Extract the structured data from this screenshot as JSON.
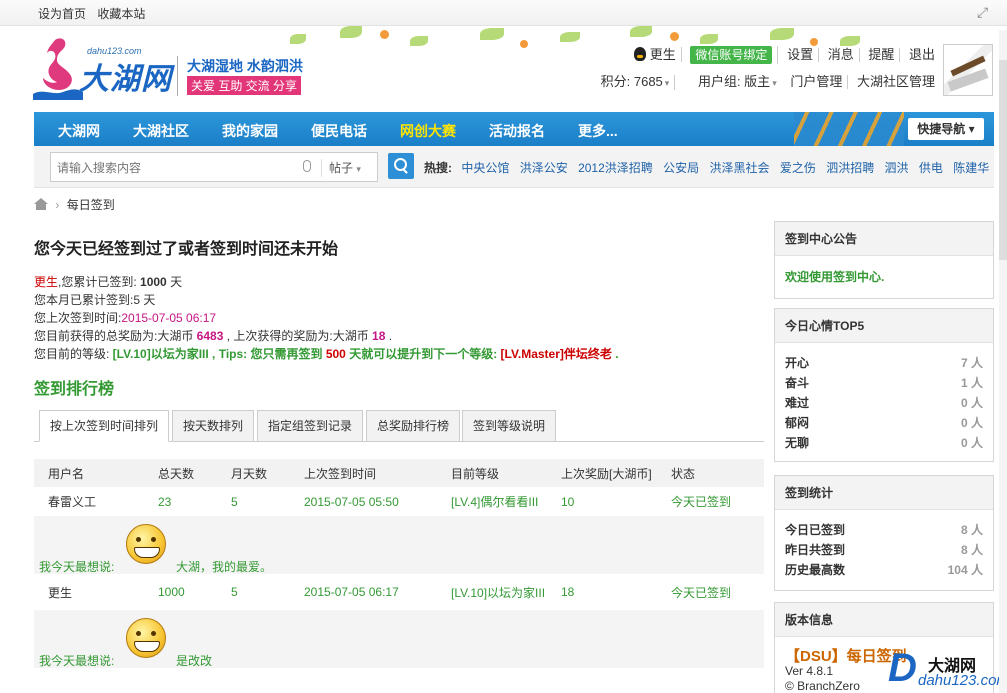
{
  "topbar": {
    "set_home": "设为首页",
    "bookmark": "收藏本站"
  },
  "logo": {
    "domain": "dahu123.com",
    "brand": "大湖网",
    "slogan1": "大湖湿地 水韵泗洪",
    "slogan2": "关爱 互助 交流 分享"
  },
  "user": {
    "name": "更生",
    "wechat": "微信账号绑定",
    "settings": "设置",
    "messages": "消息",
    "reminders": "提醒",
    "logout": "退出",
    "points": "积分: 7685",
    "group": "用户组: 版主",
    "portal_admin": "门户管理",
    "community_admin": "大湖社区管理"
  },
  "nav": {
    "items": [
      "大湖网",
      "大湖社区",
      "我的家园",
      "便民电话",
      "网创大赛",
      "活动报名",
      "更多..."
    ],
    "quick": "快捷导航"
  },
  "search": {
    "placeholder": "请输入搜索内容",
    "scope": "帖子",
    "hot_label": "热搜:",
    "hot": [
      "中央公馆",
      "洪泽公安",
      "2012洪泽招聘",
      "公安局",
      "洪泽黑社会",
      "爱之伤",
      "泗洪招聘",
      "泗洪",
      "供电",
      "陈建华"
    ]
  },
  "breadcrumb": {
    "current": "每日签到"
  },
  "main": {
    "heading": "您今天已经签到过了或者签到时间还未开始",
    "user": "更生",
    "total_prefix": ",您累计已签到: ",
    "total_days": "1000",
    "total_suffix": " 天",
    "month_line": "您本月已累计签到:5 天",
    "last_prefix": "您上次签到时间:",
    "last_time": "2015-07-05 06:17",
    "reward_prefix": "您目前获得的总奖励为:大湖币 ",
    "reward_total": "6483",
    "reward_mid": " , 上次获得的奖励为:大湖币 ",
    "reward_last": "18",
    "reward_end": " .",
    "level_prefix": "您目前的等级: ",
    "level_current": "[LV.10]以坛为家III",
    "tips_prefix": " , Tips: 您只需再签到 ",
    "tips_days": "500",
    "tips_mid": " 天就可以提升到下一个等级: ",
    "level_next": "[LV.Master]伴坛终老",
    "level_end": " .",
    "rank_title": "签到排行榜"
  },
  "tabs": [
    "按上次签到时间排列",
    "按天数排列",
    "指定组签到记录",
    "总奖励排行榜",
    "签到等级说明"
  ],
  "table": {
    "headers": [
      "用户名",
      "总天数",
      "月天数",
      "上次签到时间",
      "目前等级",
      "上次奖励[大湖币]",
      "状态"
    ],
    "rows": [
      {
        "name": "春雷义工",
        "total": "23",
        "month": "5",
        "time": "2015-07-05 05:50",
        "level": "[LV.4]偶尔看看III",
        "reward": "10",
        "status": "今天已签到",
        "mood_label": "我今天最想说:",
        "mood_text": "大湖，我的最爱。"
      },
      {
        "name": "更生",
        "total": "1000",
        "month": "5",
        "time": "2015-07-05 06:17",
        "level": "[LV.10]以坛为家III",
        "reward": "18",
        "status": "今天已签到",
        "mood_label": "我今天最想说:",
        "mood_text": "是改改"
      }
    ]
  },
  "side": {
    "notice_title": "签到中心公告",
    "notice_text": "欢迎使用签到中心.",
    "mood_title": "今日心情TOP5",
    "moods": [
      {
        "k": "开心",
        "v": "7",
        "u": "人"
      },
      {
        "k": "奋斗",
        "v": "1",
        "u": "人"
      },
      {
        "k": "难过",
        "v": "0",
        "u": "人"
      },
      {
        "k": "郁闷",
        "v": "0",
        "u": "人"
      },
      {
        "k": "无聊",
        "v": "0",
        "u": "人"
      }
    ],
    "stats_title": "签到统计",
    "stats": [
      {
        "k": "今日已签到",
        "v": "8",
        "u": "人"
      },
      {
        "k": "昨日共签到",
        "v": "8",
        "u": "人"
      },
      {
        "k": "历史最高数",
        "v": "104",
        "u": "人"
      }
    ],
    "version_title": "版本信息",
    "version_name": "【DSU】每日签到",
    "version_num": "Ver 4.8.1",
    "version_author": "© BranchZero"
  },
  "watermark": {
    "letter": "D",
    "name": "大湖网",
    "domain": "dahu123.com"
  }
}
